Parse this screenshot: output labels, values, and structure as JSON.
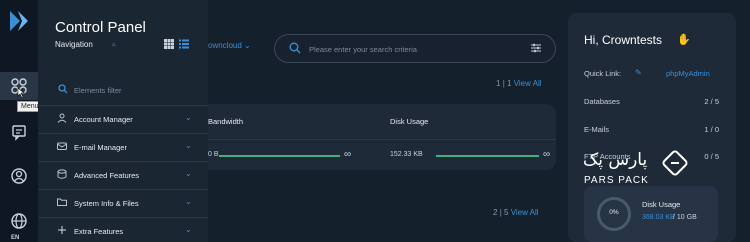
{
  "rail": {
    "icons": [
      "logo-icon",
      "apps-icon",
      "chat-icon",
      "user-icon",
      "globe-icon"
    ],
    "tooltip": "Menu",
    "lang": "EN"
  },
  "panel": {
    "title": "Control Panel",
    "subtitle": "Navigation",
    "filter_placeholder": "Elements filter",
    "items": [
      {
        "label": "Account Manager",
        "icon": "user-icon"
      },
      {
        "label": "E-mail Manager",
        "icon": "mail-icon"
      },
      {
        "label": "Advanced Features",
        "icon": "database-icon"
      },
      {
        "label": "System Info & Files",
        "icon": "folder-icon"
      },
      {
        "label": "Extra Features",
        "icon": "plus-icon"
      }
    ]
  },
  "topbar": {
    "dropdown": "owncloud",
    "search_placeholder": "Please enter your search criteria"
  },
  "section1": {
    "page": "1",
    "total": "1",
    "view_all": "View All",
    "col1": "Bandwidth",
    "col2": "Disk Usage",
    "val1": "0 B",
    "val2": "152.33 KB"
  },
  "section2": {
    "page": "2",
    "total": "5",
    "view_all": "View All"
  },
  "right": {
    "greeting": "Hi, Crowntests",
    "quick_link_label": "Quick Link:",
    "quick_link": "phpMyAdmin",
    "rows": [
      {
        "label": "Databases",
        "value": "2 / 5"
      },
      {
        "label": "E-Mails",
        "value": "1 / 0"
      },
      {
        "label": "FTP Accounts",
        "value": "0 / 5"
      }
    ],
    "disk": {
      "percent": "0%",
      "label": "Disk Usage",
      "used": "368.03 KB",
      "total": "/ 10 GB"
    }
  },
  "watermark": {
    "fa": "پارس پک",
    "en": "PARS PACK"
  },
  "colors": {
    "accent": "#3c8fd6",
    "progress": "#41b07a",
    "background": "#15202d"
  }
}
